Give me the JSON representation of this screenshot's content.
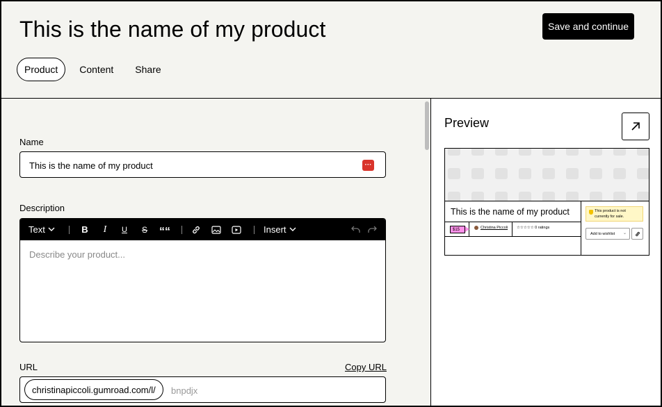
{
  "header": {
    "title": "This is the name of my product",
    "save_label": "Save and continue",
    "tabs": [
      {
        "label": "Product",
        "active": true
      },
      {
        "label": "Content",
        "active": false
      },
      {
        "label": "Share",
        "active": false
      }
    ]
  },
  "form": {
    "name_label": "Name",
    "name_value": "This is the name of my product",
    "description_label": "Description",
    "description_placeholder": "Describe your product...",
    "toolbar": {
      "text_label": "Text",
      "bold": "B",
      "italic": "I",
      "underline": "U",
      "strike": "S",
      "quote": "““",
      "insert_label": "Insert",
      "icons": [
        "link-icon",
        "image-icon",
        "video-icon",
        "undo-icon",
        "redo-icon"
      ]
    },
    "url_label": "URL",
    "copy_url_label": "Copy URL",
    "url_prefix": "christinapiccoli.gumroad.com/l/",
    "url_slug": "bnpdjx"
  },
  "preview": {
    "title": "Preview",
    "card": {
      "product_title": "This is the name of my product",
      "price": "$15",
      "creator": "Christina Piccoli",
      "ratings": "☆☆☆☆☆ 0 ratings",
      "notice": "This product is not currently for sale.",
      "wishlist_label": "Add to wishlist"
    }
  },
  "colors": {
    "background": "#f4f4f0",
    "accent_black": "#000000",
    "password_icon": "#d9342b",
    "price_badge": "#ff90e8",
    "notice_bg": "#fff7c7"
  }
}
